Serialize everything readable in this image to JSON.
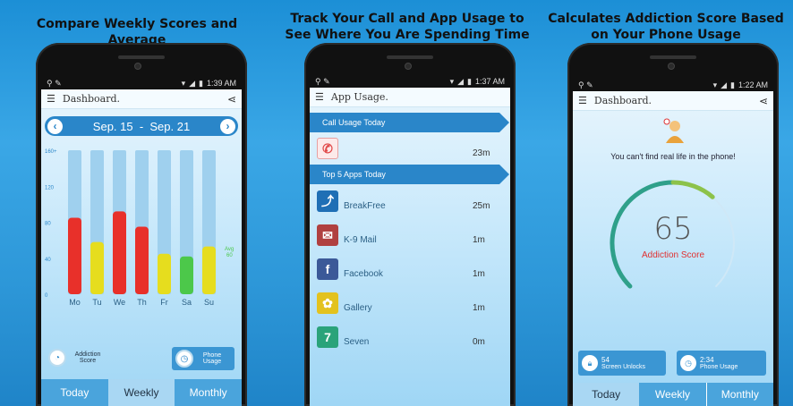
{
  "panels": [
    {
      "title": "Compare Weekly Scores and Average"
    },
    {
      "title": "Track Your Call and App Usage to See Where You Are Spending Time"
    },
    {
      "title": "Calculates Addiction Score Based on Your Phone Usage"
    }
  ],
  "screen1": {
    "status_time": "1:39 AM",
    "appbar_title": "Dashboard.",
    "date_range": "Sep. 15  -  Sep. 21",
    "prev_icon": "chevron-left-icon",
    "next_icon": "chevron-right-icon",
    "avg_label": "Avg",
    "avg_value": "60",
    "pill_addiction": "Addiction Score",
    "pill_phone": "Phone Usage",
    "tabs": [
      "Today",
      "Weekly",
      "Monthly"
    ],
    "active_tab": "Weekly"
  },
  "chart_data": {
    "type": "bar",
    "categories": [
      "Mo",
      "Tu",
      "We",
      "Th",
      "Fr",
      "Sa",
      "Su"
    ],
    "values": [
      85,
      58,
      92,
      75,
      45,
      42,
      53
    ],
    "bar_colors": [
      "#e8302a",
      "#e6dd1e",
      "#e8302a",
      "#e8302a",
      "#e6dd1e",
      "#4cc84a",
      "#e6dd1e"
    ],
    "yticks": [
      "160+",
      "120",
      "80",
      "40",
      "0"
    ],
    "ylim": [
      0,
      160
    ],
    "track_color": "#9fd0ee"
  },
  "screen2": {
    "status_time": "1:37 AM",
    "appbar_title": "App Usage.",
    "call_header": "Call Usage Today",
    "call_value": "23m",
    "apps_header": "Top 5 Apps Today",
    "apps": [
      {
        "name": "BreakFree",
        "value": "25m",
        "icon": "breakfree-icon",
        "color": "#1f6fb5"
      },
      {
        "name": "K-9 Mail",
        "value": "1m",
        "icon": "k9-mail-icon",
        "color": "#b04040"
      },
      {
        "name": "Facebook",
        "value": "1m",
        "icon": "facebook-icon",
        "color": "#3b5998"
      },
      {
        "name": "Gallery",
        "value": "1m",
        "icon": "gallery-icon",
        "color": "#e3c21e"
      },
      {
        "name": "Seven",
        "value": "0m",
        "icon": "seven-icon",
        "color": "#2aa37a"
      }
    ]
  },
  "screen3": {
    "status_time": "1:22 AM",
    "appbar_title": "Dashboard.",
    "message": "You can't find real life in the phone!",
    "score": "65",
    "score_label": "Addiction Score",
    "gauge_value": 65,
    "unlocks_value": "54",
    "unlocks_label": "Screen Unlocks",
    "usage_value": "2:34",
    "usage_label": "Phone Usage",
    "tabs": [
      "Today",
      "Weekly",
      "Monthly"
    ],
    "active_tab": "Today"
  }
}
